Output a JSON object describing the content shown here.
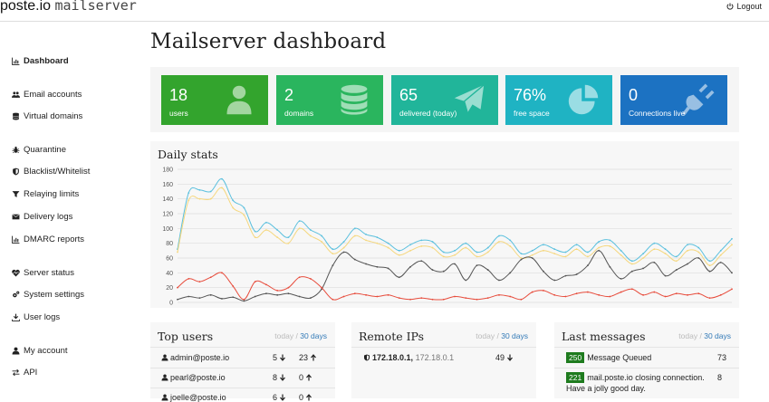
{
  "app": {
    "brand_main": "poste.io",
    "brand_sub": "mailserver",
    "logout_label": "Logout"
  },
  "sidebar": {
    "items": [
      {
        "label": "Dashboard",
        "icon": "bar-chart-icon"
      },
      {
        "label": "Email accounts",
        "icon": "users-icon"
      },
      {
        "label": "Virtual domains",
        "icon": "database-icon"
      },
      {
        "label": "Quarantine",
        "icon": "bug-icon"
      },
      {
        "label": "Blacklist/Whitelist",
        "icon": "shield-icon"
      },
      {
        "label": "Relaying limits",
        "icon": "filter-icon"
      },
      {
        "label": "Delivery logs",
        "icon": "envelope-icon"
      },
      {
        "label": "DMARC reports",
        "icon": "bar-chart-icon"
      },
      {
        "label": "Server status",
        "icon": "heartbeat-icon"
      },
      {
        "label": "System settings",
        "icon": "cogs-icon"
      },
      {
        "label": "User logs",
        "icon": "download-icon"
      },
      {
        "label": "My account",
        "icon": "user-icon"
      },
      {
        "label": "API",
        "icon": "exchange-icon"
      }
    ]
  },
  "main": {
    "title": "Mailserver dashboard",
    "tiles": [
      {
        "value": "18",
        "label": "users",
        "color": "#33a42d",
        "icon": "user-icon"
      },
      {
        "value": "2",
        "label": "domains",
        "color": "#2ab55e",
        "icon": "database-icon"
      },
      {
        "value": "65",
        "label": "delivered (today)",
        "color": "#21b59a",
        "icon": "paper-plane-icon"
      },
      {
        "value": "76%",
        "label": "free space",
        "color": "#1fb3c3",
        "icon": "pie-chart-icon"
      },
      {
        "value": "0",
        "label": "Connections live",
        "color": "#1c72c2",
        "icon": "plug-icon"
      }
    ],
    "daily_stats": {
      "title": "Daily stats"
    },
    "top_users": {
      "title": "Top users",
      "range_today": "today",
      "range_sep": "/",
      "range_30": "30 days",
      "rows": [
        {
          "email": "admin@poste.io",
          "sent": "5",
          "received": "23"
        },
        {
          "email": "pearl@poste.io",
          "sent": "8",
          "received": "0"
        },
        {
          "email": "joelle@poste.io",
          "sent": "6",
          "received": "0"
        }
      ]
    },
    "remote_ips": {
      "title": "Remote IPs",
      "range_today": "today",
      "range_sep": "/",
      "range_30": "30 days",
      "rows": [
        {
          "ip": "172.18.0.1",
          "host": "172.18.0.1",
          "count": "49"
        }
      ]
    },
    "last_messages": {
      "title": "Last messages",
      "range_today": "today",
      "range_sep": "/",
      "range_30": "30 days",
      "rows": [
        {
          "code": "250",
          "text": "Message Queued",
          "count": "73"
        },
        {
          "code": "221",
          "text": "mail.poste.io closing connection.",
          "text2": "Have a jolly good day.",
          "count": "8"
        }
      ]
    }
  },
  "chart_data": {
    "type": "line",
    "title": "Daily stats",
    "ylim": [
      0,
      180
    ],
    "yticks": [
      0,
      20,
      40,
      60,
      80,
      100,
      120,
      140,
      160,
      180
    ],
    "grid": true,
    "series": [
      {
        "color": "#5bc0de",
        "values": [
          72,
          148,
          152,
          150,
          167,
          138,
          128,
          96,
          108,
          98,
          88,
          110,
          98,
          90,
          72,
          82,
          100,
          92,
          88,
          80,
          70,
          78,
          84,
          82,
          68,
          70,
          80,
          68,
          74,
          90,
          84,
          66,
          70,
          78,
          72,
          68,
          78,
          68,
          82,
          84,
          70,
          56,
          66,
          80,
          72,
          62,
          78,
          74,
          56,
          70,
          86
        ]
      },
      {
        "color": "#f5d77e",
        "values": [
          68,
          138,
          140,
          140,
          155,
          128,
          118,
          88,
          98,
          88,
          80,
          100,
          90,
          82,
          66,
          74,
          90,
          84,
          80,
          74,
          64,
          70,
          76,
          74,
          62,
          64,
          74,
          62,
          68,
          82,
          76,
          60,
          64,
          70,
          66,
          62,
          72,
          62,
          74,
          76,
          64,
          52,
          60,
          72,
          66,
          56,
          70,
          68,
          50,
          64,
          78
        ]
      },
      {
        "color": "#555555",
        "values": [
          4,
          8,
          6,
          10,
          5,
          7,
          2,
          8,
          12,
          10,
          12,
          8,
          6,
          18,
          50,
          68,
          58,
          52,
          48,
          46,
          34,
          48,
          56,
          44,
          42,
          52,
          30,
          50,
          44,
          30,
          40,
          58,
          60,
          42,
          30,
          36,
          38,
          50,
          70,
          48,
          32,
          42,
          46,
          54,
          36,
          44,
          52,
          60,
          42,
          54,
          40
        ]
      },
      {
        "color": "#e74c3c",
        "values": [
          20,
          32,
          28,
          34,
          40,
          22,
          4,
          28,
          24,
          16,
          20,
          34,
          32,
          20,
          4,
          8,
          12,
          10,
          8,
          10,
          6,
          4,
          6,
          4,
          4,
          8,
          6,
          4,
          6,
          10,
          8,
          4,
          14,
          16,
          10,
          8,
          12,
          14,
          10,
          8,
          14,
          18,
          10,
          14,
          8,
          12,
          10,
          12,
          6,
          10,
          18
        ]
      }
    ]
  }
}
